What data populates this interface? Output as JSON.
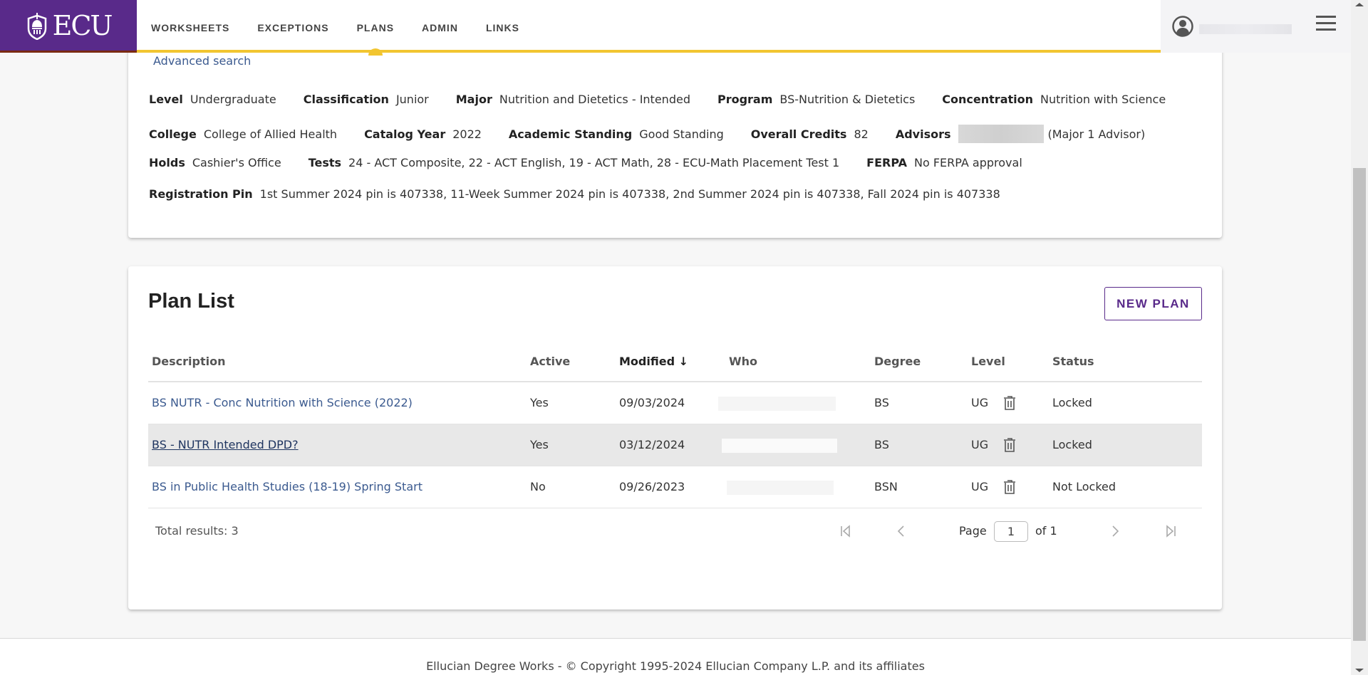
{
  "header": {
    "logo_text": "ECU",
    "nav": [
      {
        "label": "WORKSHEETS",
        "active": false
      },
      {
        "label": "EXCEPTIONS",
        "active": false
      },
      {
        "label": "PLANS",
        "active": true
      },
      {
        "label": "ADMIN",
        "active": false
      },
      {
        "label": "LINKS",
        "active": false
      }
    ],
    "accent_color": "#f2c530",
    "brand_color": "#592a8a"
  },
  "student_info": {
    "advanced_search_label": "Advanced search",
    "rows": [
      [
        {
          "label": "Level",
          "value": "Undergraduate"
        },
        {
          "label": "Classification",
          "value": "Junior"
        },
        {
          "label": "Major",
          "value": "Nutrition and Dietetics - Intended"
        },
        {
          "label": "Program",
          "value": "BS-Nutrition & Dietetics"
        },
        {
          "label": "Concentration",
          "value": "Nutrition with Science"
        }
      ],
      [
        {
          "label": "College",
          "value": "College of Allied Health"
        },
        {
          "label": "Catalog Year",
          "value": "2022"
        },
        {
          "label": "Academic Standing",
          "value": "Good Standing"
        },
        {
          "label": "Overall Credits",
          "value": "82"
        },
        {
          "label": "Advisors",
          "value": "(Major 1 Advisor)"
        }
      ],
      [
        {
          "label": "Holds",
          "value": "Cashier's Office"
        },
        {
          "label": "Tests",
          "value": "24 - ACT Composite, 22 - ACT English, 19 - ACT Math, 28 - ECU-Math Placement Test 1"
        },
        {
          "label": "FERPA",
          "value": "No FERPA approval"
        }
      ],
      [
        {
          "label": "Registration Pin",
          "value": "1st Summer 2024 pin is 407338, 11-Week Summer 2024 pin is 407338, 2nd Summer 2024 pin is 407338, Fall 2024 pin is 407338"
        }
      ]
    ]
  },
  "plan_list": {
    "title": "Plan List",
    "new_plan_label": "NEW PLAN",
    "columns": {
      "description": "Description",
      "active": "Active",
      "modified": "Modified",
      "sort_indicator": "↓",
      "who": "Who",
      "degree": "Degree",
      "level": "Level",
      "status": "Status"
    },
    "rows": [
      {
        "description": "BS NUTR - Conc Nutrition with Science (2022)",
        "active": "Yes",
        "modified": "09/03/2024",
        "degree": "BS",
        "level": "UG",
        "status": "Locked"
      },
      {
        "description": "BS - NUTR Intended DPD?",
        "active": "Yes",
        "modified": "03/12/2024",
        "degree": "BS",
        "level": "UG",
        "status": "Locked"
      },
      {
        "description": "BS in Public Health Studies (18-19) Spring Start",
        "active": "No",
        "modified": "09/26/2023",
        "degree": "BSN",
        "level": "UG",
        "status": "Not Locked"
      }
    ],
    "total_results": "Total results: 3",
    "pagination": {
      "page_label": "Page",
      "current_page": "1",
      "of_label": "of 1"
    }
  },
  "footer": {
    "text": "Ellucian Degree Works - © Copyright 1995-2024 Ellucian Company L.P. and its affiliates"
  }
}
